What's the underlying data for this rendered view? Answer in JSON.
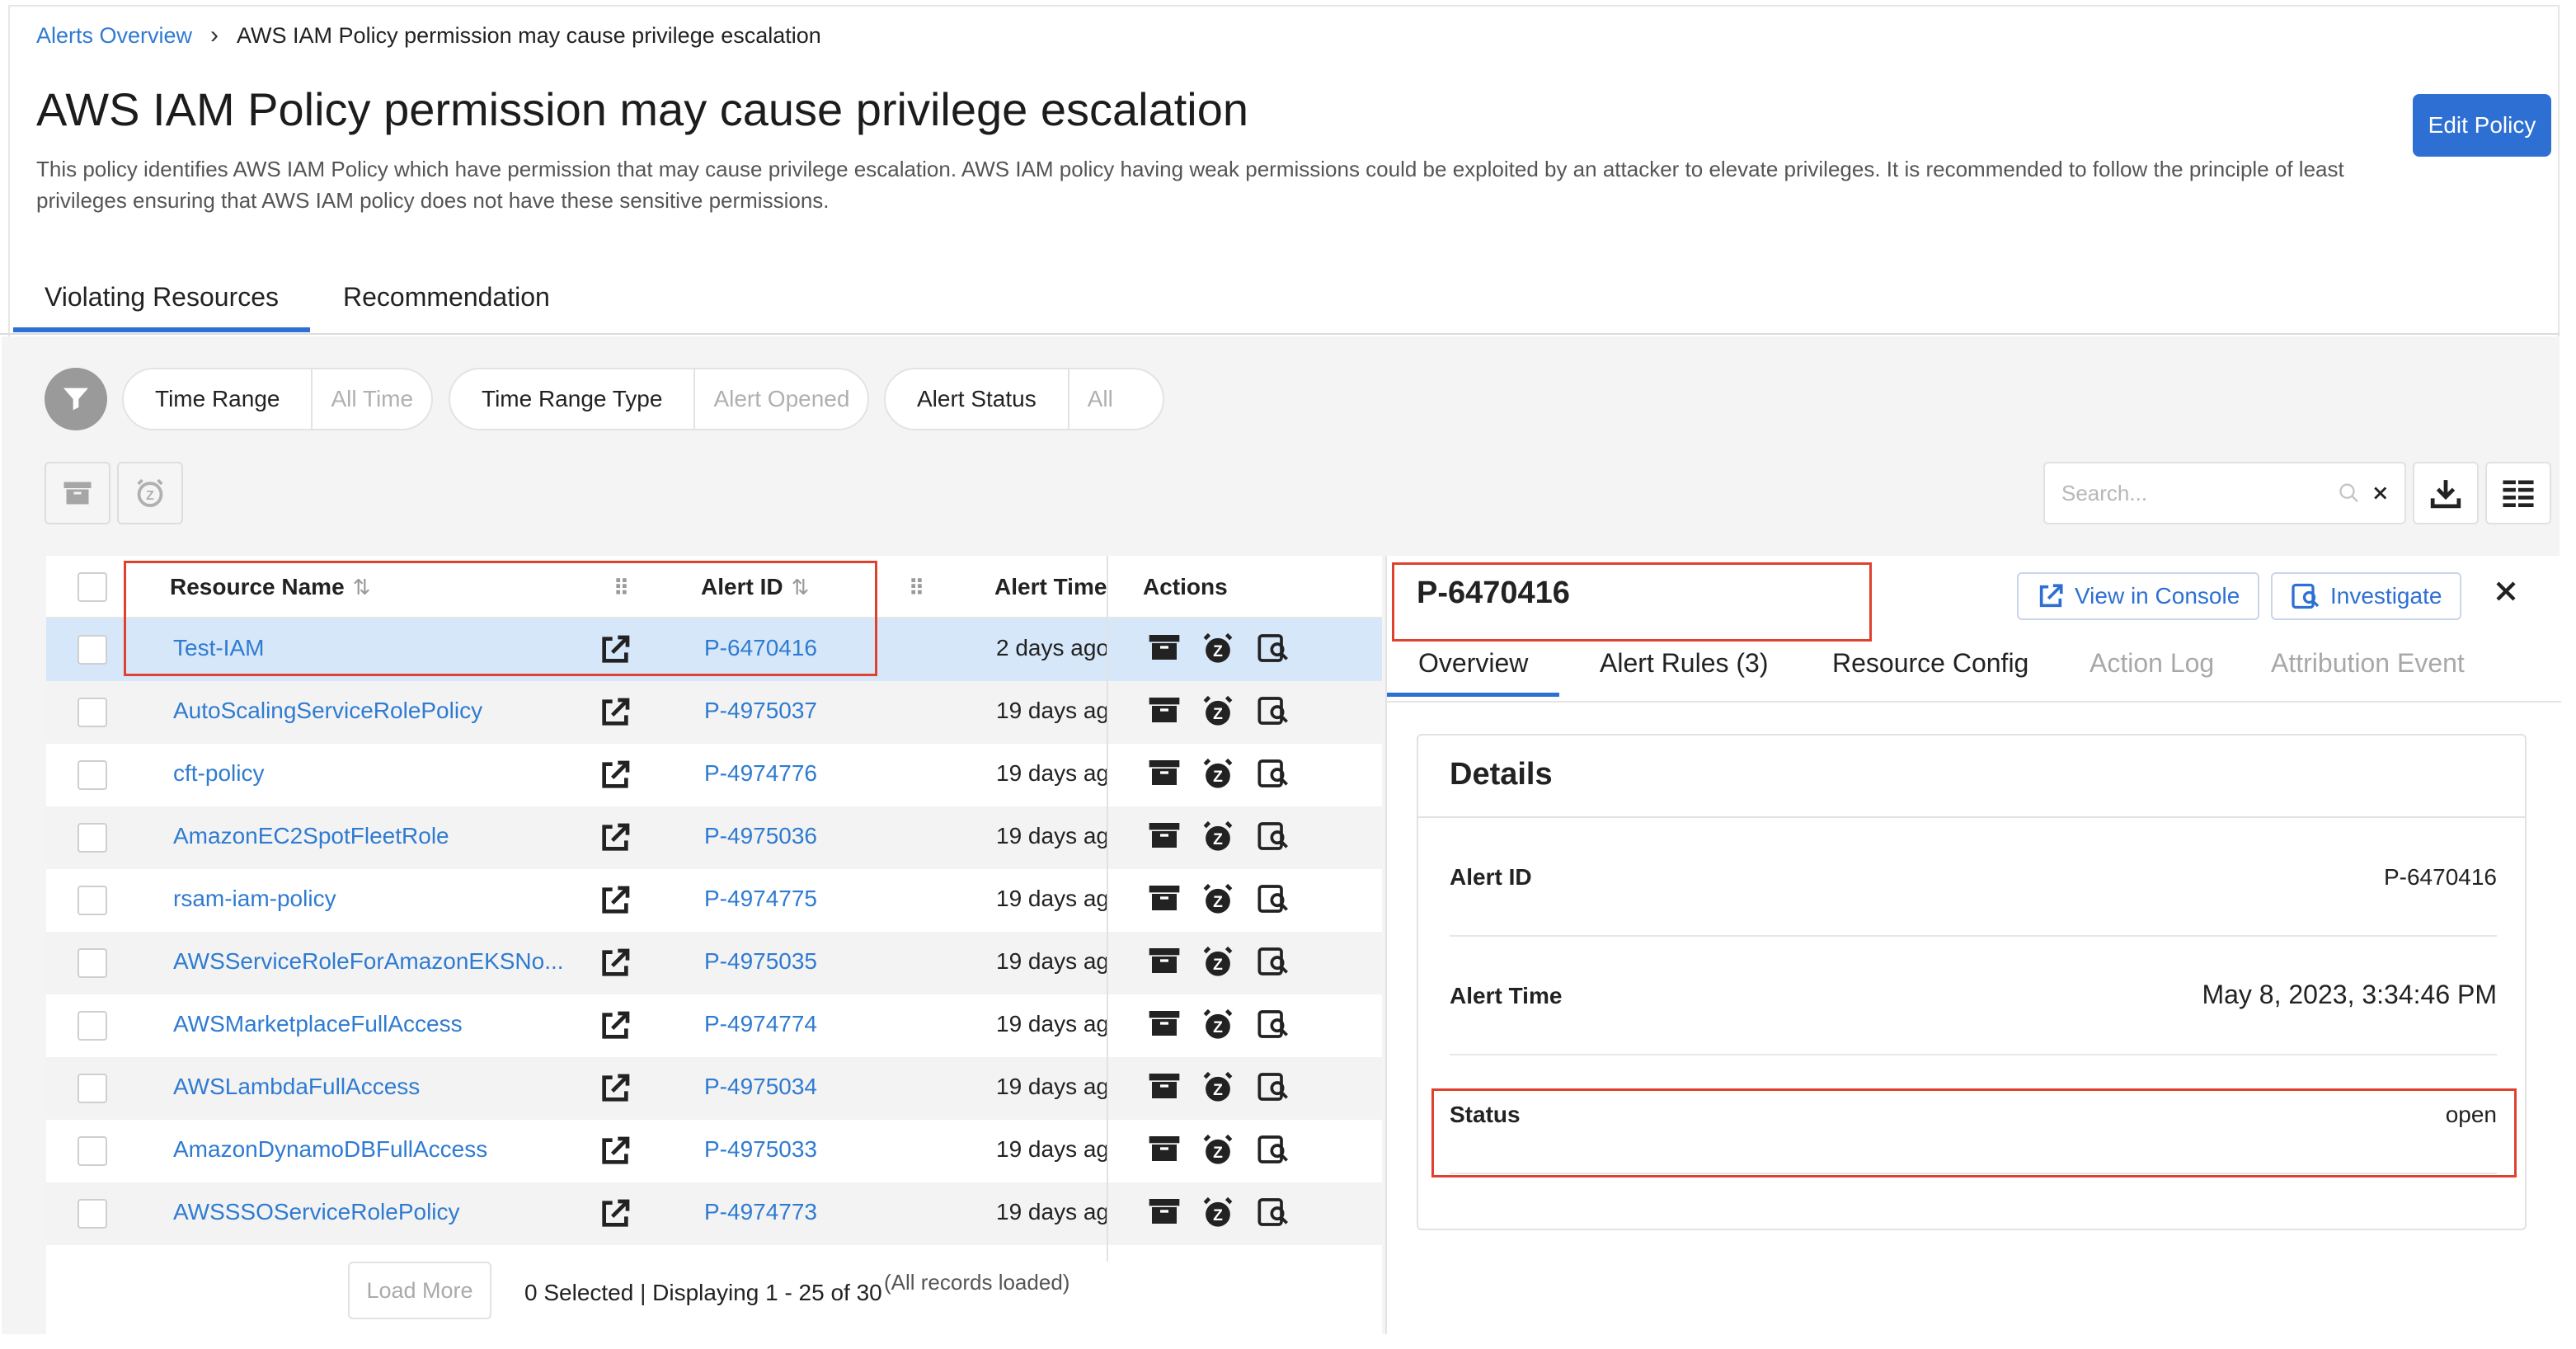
{
  "breadcrumb": {
    "parent": "Alerts Overview",
    "current": "AWS IAM Policy permission may cause privilege escalation"
  },
  "page": {
    "title": "AWS IAM Policy permission may cause privilege escalation",
    "description": "This policy identifies AWS IAM Policy which have permission that may cause privilege escalation. AWS IAM policy having weak permissions could be exploited by an attacker to elevate privileges. It is recommended to follow the principle of least privileges ensuring that AWS IAM policy does not have these sensitive permissions.",
    "edit_label": "Edit Policy"
  },
  "tabs": [
    "Violating Resources",
    "Recommendation"
  ],
  "filters": [
    {
      "key": "Time Range",
      "value": "All Time"
    },
    {
      "key": "Time Range Type",
      "value": "Alert Opened"
    },
    {
      "key": "Alert Status",
      "value": "All"
    }
  ],
  "search": {
    "placeholder": "Search..."
  },
  "table": {
    "columns": [
      "Resource Name",
      "Alert ID",
      "Alert Time",
      "Actions"
    ],
    "rows": [
      {
        "name": "Test-IAM",
        "id": "P-6470416",
        "time": "2 days ago"
      },
      {
        "name": "AutoScalingServiceRolePolicy",
        "id": "P-4975037",
        "time": "19 days ago"
      },
      {
        "name": "cft-policy",
        "id": "P-4974776",
        "time": "19 days ago"
      },
      {
        "name": "AmazonEC2SpotFleetRole",
        "id": "P-4975036",
        "time": "19 days ago"
      },
      {
        "name": "rsam-iam-policy",
        "id": "P-4974775",
        "time": "19 days ago"
      },
      {
        "name": "AWSServiceRoleForAmazonEKSNo...",
        "id": "P-4975035",
        "time": "19 days ago"
      },
      {
        "name": "AWSMarketplaceFullAccess",
        "id": "P-4974774",
        "time": "19 days ago"
      },
      {
        "name": "AWSLambdaFullAccess",
        "id": "P-4975034",
        "time": "19 days ago"
      },
      {
        "name": "AmazonDynamoDBFullAccess",
        "id": "P-4975033",
        "time": "19 days ago"
      },
      {
        "name": "AWSSSOServiceRolePolicy",
        "id": "P-4974773",
        "time": "19 days ago"
      }
    ]
  },
  "footer": {
    "load_more": "Load More",
    "status": "0 Selected | Displaying 1 - 25 of 30",
    "note": "(All records loaded)"
  },
  "panel": {
    "title": "P-6470416",
    "view_console": "View in Console",
    "investigate": "Investigate",
    "tabs": [
      "Overview",
      "Alert Rules (3)",
      "Resource Config",
      "Action Log",
      "Attribution Event"
    ],
    "details_title": "Details",
    "details": [
      {
        "key": "Alert ID",
        "value": "P-6470416"
      },
      {
        "key": "Alert Time",
        "value": "May 8, 2023, 3:34:46 PM"
      },
      {
        "key": "Status",
        "value": "open"
      }
    ]
  },
  "colors": {
    "accent": "#2d6fd3",
    "link": "#2f7bd1",
    "highlight": "#e0412e",
    "selected_row": "#d6e7fa"
  }
}
